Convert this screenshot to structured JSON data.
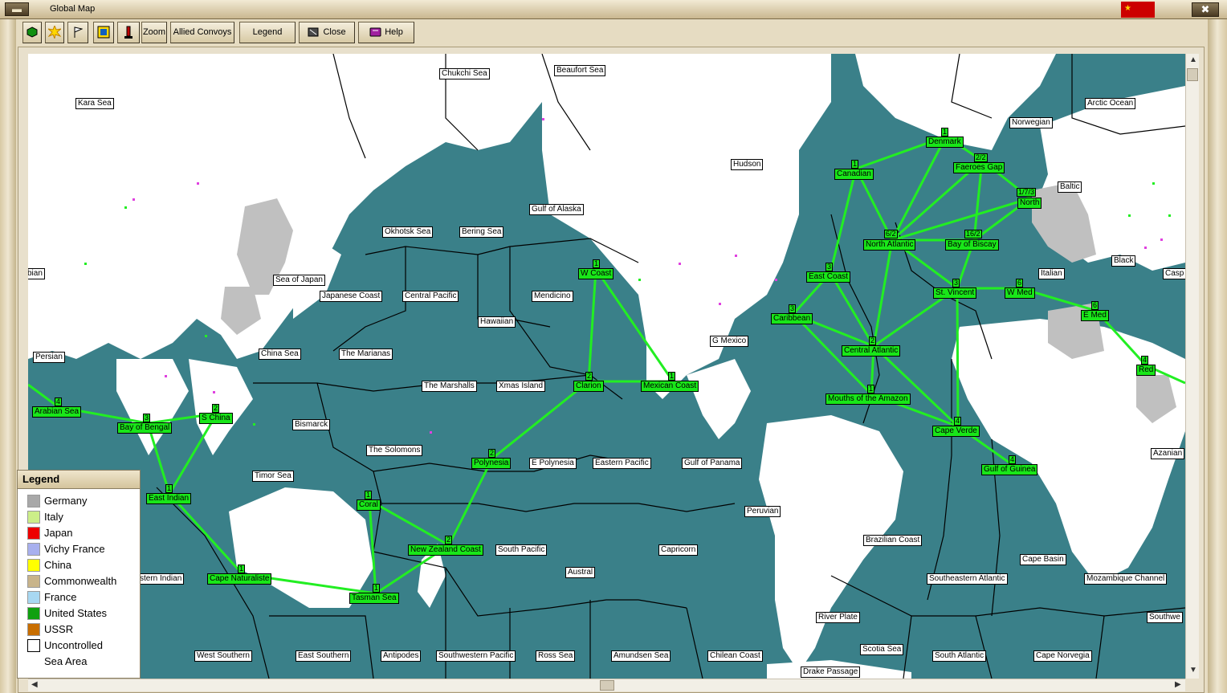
{
  "window": {
    "title": "Global Map",
    "title_icon": "game-menu-icon"
  },
  "toolbar": {
    "zoom": "Zoom",
    "allied_convoys": "Allied Convoys",
    "legend": "Legend",
    "close": "Close",
    "help": "Help"
  },
  "colors": {
    "sea": "#3a8089",
    "land": "#ffffff",
    "germany_land": "#c0c0c0",
    "route": "#22ee22",
    "route_label": "#19e619",
    "ussr_flag": "#cc0000"
  },
  "map": {
    "sea_areas": [
      {
        "name": "Kara Sea"
      },
      {
        "name": "Chukchi Sea"
      },
      {
        "name": "Beaufort Sea"
      },
      {
        "name": "Arctic Ocean"
      },
      {
        "name": "Norwegian"
      },
      {
        "name": "Hudson"
      },
      {
        "name": "Baltic"
      },
      {
        "name": "Gulf of Alaska"
      },
      {
        "name": "Okhotsk Sea"
      },
      {
        "name": "Bering Sea"
      },
      {
        "name": "Black"
      },
      {
        "name": "bian"
      },
      {
        "name": "Sea of Japan"
      },
      {
        "name": "Italian"
      },
      {
        "name": "Casp"
      },
      {
        "name": "Japanese Coast"
      },
      {
        "name": "Central Pacific"
      },
      {
        "name": "Mendicino"
      },
      {
        "name": "Hawaiian"
      },
      {
        "name": "Persian"
      },
      {
        "name": "China Sea"
      },
      {
        "name": "The Marianas"
      },
      {
        "name": "G Mexico"
      },
      {
        "name": "The Marshalls"
      },
      {
        "name": "Xmas Island"
      },
      {
        "name": "Bismarck"
      },
      {
        "name": "The Solomons"
      },
      {
        "name": "E Polynesia"
      },
      {
        "name": "Eastern Pacific"
      },
      {
        "name": "Gulf of Panama"
      },
      {
        "name": "Azanian"
      },
      {
        "name": "Timor Sea"
      },
      {
        "name": "Peruvian"
      },
      {
        "name": "Brazilian Coast"
      },
      {
        "name": "South Pacific"
      },
      {
        "name": "Capricorn"
      },
      {
        "name": "Cape Basin"
      },
      {
        "name": "Austral"
      },
      {
        "name": "stern Indian"
      },
      {
        "name": "Southeastern Atlantic"
      },
      {
        "name": "Mozambique Channel"
      },
      {
        "name": "River Plate"
      },
      {
        "name": "Southwe"
      },
      {
        "name": "Scotia Sea"
      },
      {
        "name": "West Southern"
      },
      {
        "name": "East Southern"
      },
      {
        "name": "Antipodes"
      },
      {
        "name": "Southwestern Pacific"
      },
      {
        "name": "Ross Sea"
      },
      {
        "name": "Amundsen Sea"
      },
      {
        "name": "Chilean Coast"
      },
      {
        "name": "South Atlantic"
      },
      {
        "name": "Cape Norvegia"
      },
      {
        "name": "Drake Passage"
      }
    ],
    "convoy_zones": [
      {
        "name": "Denmark",
        "count": "1"
      },
      {
        "name": "Faeroes Gap",
        "count": "2/2"
      },
      {
        "name": "Canadian",
        "count": "1"
      },
      {
        "name": "North",
        "count": "1/7/3"
      },
      {
        "name": "North Atlantic",
        "count": "6/2"
      },
      {
        "name": "Bay of Biscay",
        "count": "16/2"
      },
      {
        "name": "W Coast",
        "count": "1"
      },
      {
        "name": "East Coast",
        "count": "3"
      },
      {
        "name": "St. Vincent",
        "count": "3"
      },
      {
        "name": "W Med",
        "count": "6"
      },
      {
        "name": "E Med",
        "count": "6"
      },
      {
        "name": "Caribbean",
        "count": "3"
      },
      {
        "name": "Central Atlantic",
        "count": "2"
      },
      {
        "name": "Red",
        "count": "4"
      },
      {
        "name": "Clarion",
        "count": "2"
      },
      {
        "name": "Mexican Coast",
        "count": "1"
      },
      {
        "name": "Mouths of the Amazon",
        "count": "1"
      },
      {
        "name": "Arabian Sea",
        "count": "4"
      },
      {
        "name": "S China",
        "count": "2"
      },
      {
        "name": "Bay of Bengal",
        "count": "3"
      },
      {
        "name": "Cape Verde",
        "count": "4"
      },
      {
        "name": "Polynesia",
        "count": "2"
      },
      {
        "name": "Gulf of Guinea",
        "count": "4"
      },
      {
        "name": "East Indian",
        "count": "1"
      },
      {
        "name": "Coral",
        "count": "1"
      },
      {
        "name": "New Zealand Coast",
        "count": "2"
      },
      {
        "name": "Cape Naturaliste",
        "count": "1"
      },
      {
        "name": "Tasman Sea",
        "count": "1"
      }
    ]
  },
  "legend": {
    "title": "Legend",
    "items": [
      {
        "label": "Germany",
        "color": "#a8a8a8"
      },
      {
        "label": "Italy",
        "color": "#ccee88"
      },
      {
        "label": "Japan",
        "color": "#ee0000"
      },
      {
        "label": "Vichy France",
        "color": "#a8b0ee"
      },
      {
        "label": "China",
        "color": "#ffff00"
      },
      {
        "label": "Commonwealth",
        "color": "#c8b48a"
      },
      {
        "label": "France",
        "color": "#a8d8f2"
      },
      {
        "label": "United States",
        "color": "#10a010"
      },
      {
        "label": "USSR",
        "color": "#c86e00"
      },
      {
        "label": "Uncontrolled",
        "color": "#ffffff"
      },
      {
        "label": "Sea Area",
        "color": "#3a8089"
      }
    ]
  }
}
